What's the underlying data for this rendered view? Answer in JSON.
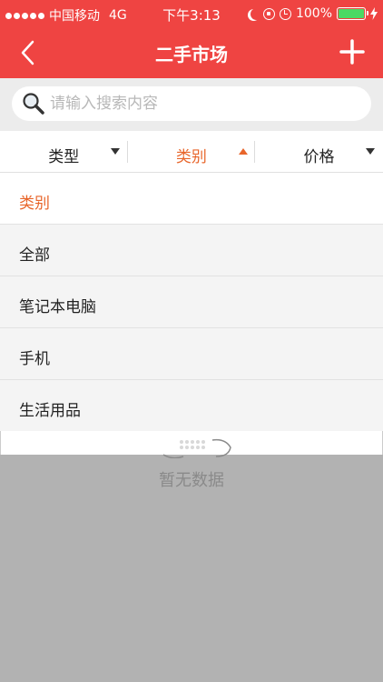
{
  "status_bar": {
    "carrier": "中国移动",
    "network": "4G",
    "time": "下午3:13",
    "battery": "100%"
  },
  "nav": {
    "title": "二手市场",
    "back_icon": "chevron-left-icon",
    "add_icon": "plus-icon"
  },
  "search": {
    "placeholder": "请输入搜索内容",
    "icon": "magnifier-icon"
  },
  "filters": [
    {
      "label": "类型",
      "state": "collapsed"
    },
    {
      "label": "类别",
      "state": "expanded"
    },
    {
      "label": "价格",
      "state": "collapsed"
    }
  ],
  "dropdown": {
    "header": "类别",
    "options": [
      "全部",
      "笔记本电脑",
      "手机",
      "生活用品"
    ]
  },
  "empty_state": {
    "text": "暂无数据"
  },
  "colors": {
    "brand": "#ef4442",
    "accent": "#e8652a",
    "overlay": "#b2b2b2"
  }
}
